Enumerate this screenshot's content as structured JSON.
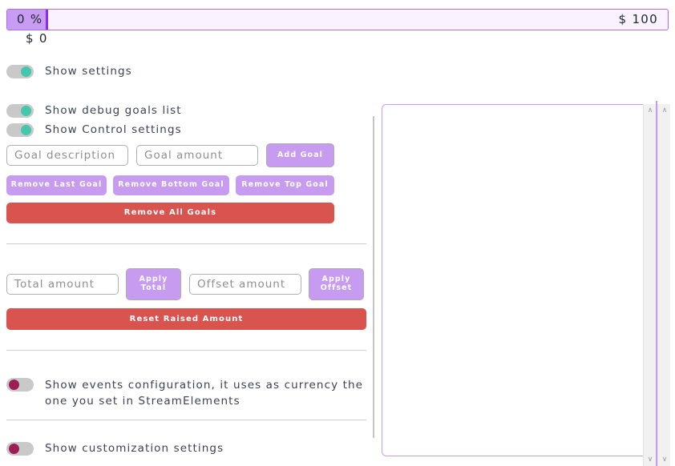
{
  "progress": {
    "percent_label": "0 %",
    "total_label": "$ 100",
    "raised_label": "$ 0",
    "fill_percent": 0,
    "fill_color": "#c89cf2",
    "marker_color": "#8b2ef0",
    "track_color": "#faf3ff",
    "border_color": "#b06cf0"
  },
  "toggles": {
    "show_settings": {
      "label": "Show settings",
      "state": "on"
    },
    "show_debug_goals_list": {
      "label": "Show debug goals list",
      "state": "on"
    },
    "show_control_settings": {
      "label": "Show Control settings",
      "state": "on"
    },
    "show_events_configuration": {
      "label": "Show events configuration, it uses as currency the one you set in StreamElements",
      "state": "off"
    },
    "show_customization_settings": {
      "label": "Show customization settings",
      "state": "off"
    }
  },
  "goals_section": {
    "goal_description_placeholder": "Goal description",
    "goal_description_value": "",
    "goal_amount_placeholder": "Goal amount",
    "goal_amount_value": "",
    "add_goal_label": "Add Goal",
    "remove_last_goal_label": "Remove Last Goal",
    "remove_bottom_goal_label": "Remove Bottom Goal",
    "remove_top_goal_label": "Remove Top Goal",
    "remove_all_goals_label": "Remove All Goals"
  },
  "amount_section": {
    "total_amount_placeholder": "Total amount",
    "total_amount_value": "",
    "apply_total_line1": "Apply",
    "apply_total_line2": "Total",
    "offset_amount_placeholder": "Offset amount",
    "offset_amount_value": "",
    "apply_offset_line1": "Apply",
    "apply_offset_line2": "Offset",
    "reset_raised_amount_label": "Reset Raised Amount"
  },
  "scrollbars": {
    "up_arrow_glyph": "∧",
    "down_arrow_glyph": "∨"
  },
  "colors": {
    "toggle_on_knob": "#45c7ab",
    "toggle_off_knob": "#9c1f53",
    "toggle_track": "#c9c9c9",
    "purple_button": "#c79bf0",
    "red_button": "#d9534f",
    "text": "#3a4354",
    "panel_border": "#c79bf0"
  }
}
